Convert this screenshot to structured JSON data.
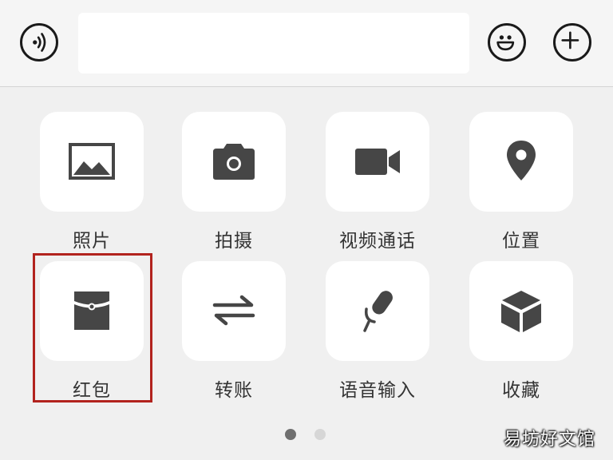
{
  "input_bar": {
    "voice_icon": "voice-wave-icon",
    "message_value": "",
    "emoji_icon": "smiley-face-icon",
    "more_icon": "plus-circle-icon"
  },
  "panel": {
    "items": [
      {
        "label": "照片",
        "icon": "image-icon"
      },
      {
        "label": "拍摄",
        "icon": "camera-icon"
      },
      {
        "label": "视频通话",
        "icon": "video-camera-icon"
      },
      {
        "label": "位置",
        "icon": "location-pin-icon"
      },
      {
        "label": "红包",
        "icon": "red-packet-icon"
      },
      {
        "label": "转账",
        "icon": "transfer-arrows-icon"
      },
      {
        "label": "语音输入",
        "icon": "microphone-icon"
      },
      {
        "label": "收藏",
        "icon": "cube-icon"
      }
    ],
    "highlighted_item": "红包",
    "page_indicator": {
      "current": 1,
      "total": 2
    }
  },
  "watermark": "易坊好文馆",
  "colors": {
    "highlight_border": "#b2231e",
    "icon_fill": "#464646",
    "label_text": "#333333"
  }
}
